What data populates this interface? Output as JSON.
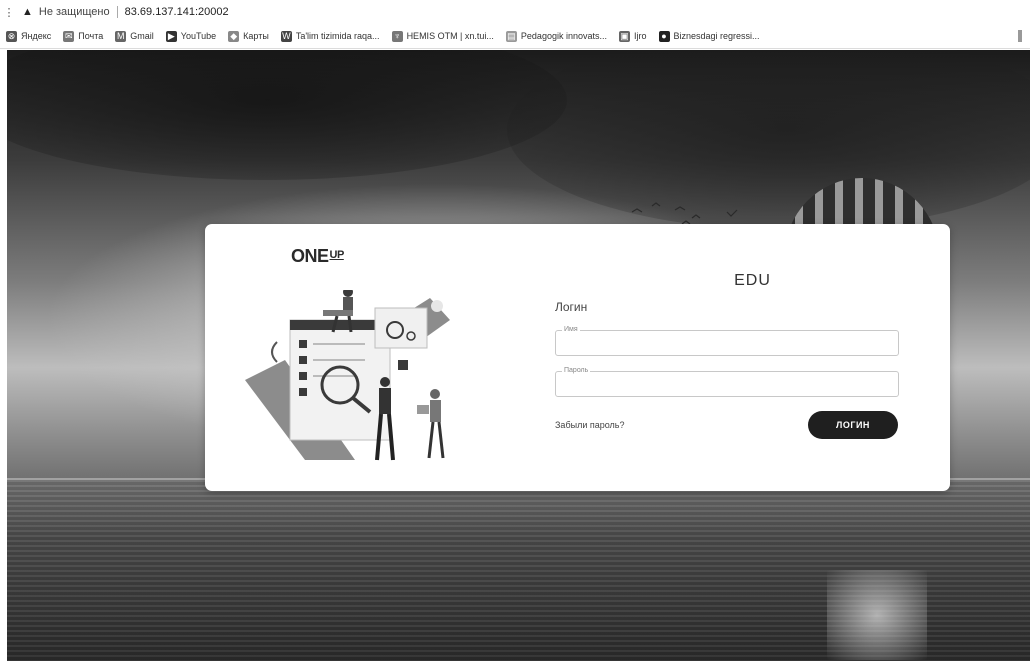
{
  "browser": {
    "pin_glyph": "⋮",
    "warning_icon": "warning-icon",
    "security_label": "Не защищено",
    "url": "83.69.137.141:20002"
  },
  "bookmarks": [
    {
      "label": "Яндекс",
      "icon": "yandex-icon",
      "color": "#555555"
    },
    {
      "label": "Почта",
      "icon": "mail-icon",
      "color": "#777777"
    },
    {
      "label": "Gmail",
      "icon": "gmail-icon",
      "color": "#666666"
    },
    {
      "label": "YouTube",
      "icon": "youtube-icon",
      "color": "#333333"
    },
    {
      "label": "Карты",
      "icon": "maps-icon",
      "color": "#888888"
    },
    {
      "label": "Ta'lim tizimida raqa...",
      "icon": "wordpress-icon",
      "color": "#444444"
    },
    {
      "label": "HEMIS OTM | xn.tui...",
      "icon": "hemis-icon",
      "color": "#777777"
    },
    {
      "label": "Pedagogik innovats...",
      "icon": "doc-icon",
      "color": "#999999"
    },
    {
      "label": "Ijro",
      "icon": "ijro-icon",
      "color": "#666666"
    },
    {
      "label": "Biznesdagi regressi...",
      "icon": "globe-icon",
      "color": "#222222"
    }
  ],
  "card": {
    "brand_main": "ON",
    "brand_e": "E",
    "brand_up": "UP",
    "title": "EDU",
    "heading": "Логин",
    "name_label": "Имя",
    "password_label": "Пароль",
    "name_value": "",
    "password_value": "",
    "forgot_link": "Забыли пароль?",
    "login_button": "ЛОГИН"
  }
}
